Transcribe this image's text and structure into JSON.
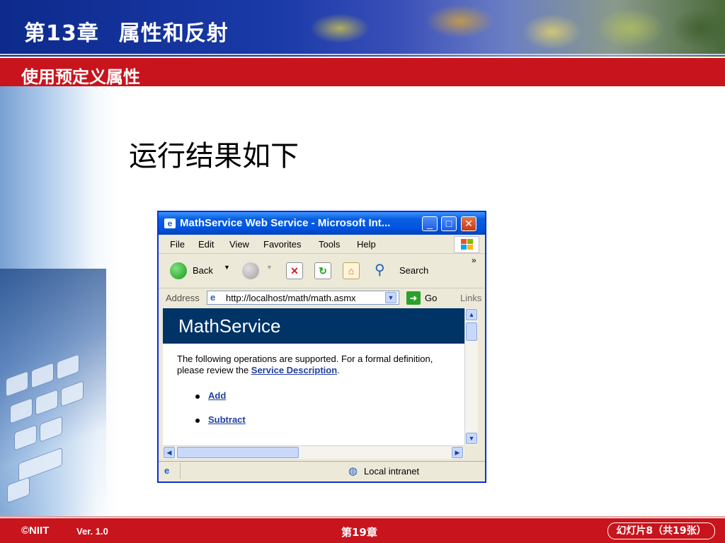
{
  "slide": {
    "title_part1": "第13章",
    "title_part2": "属性和反射",
    "subtitle": "使用预定义属性",
    "heading": "运行结果如下"
  },
  "browser": {
    "window_title": "MathService Web Service - Microsoft Int...",
    "menu": [
      "File",
      "Edit",
      "View",
      "Favorites",
      "Tools",
      "Help"
    ],
    "toolbar": {
      "back_label": "Back",
      "search_label": "Search",
      "more_label": "»"
    },
    "address": {
      "label": "Address",
      "url": "http://localhost/math/math.asmx",
      "go_label": "Go",
      "links_label": "Links"
    },
    "page": {
      "service_name": "MathService",
      "intro_text": "The following operations are supported. For a formal definition, please review the ",
      "service_description_link": "Service Description",
      "intro_end": ".",
      "operations": [
        "Add",
        "Subtract"
      ]
    },
    "status": {
      "zone_label": "Local intranet"
    }
  },
  "footer": {
    "logo": "©NIIT",
    "version": "Ver. 1.0",
    "chapter": "第19章",
    "slide_counter": "幻灯片8（共19张）"
  },
  "colors": {
    "header_blue": "#0d2a8c",
    "accent_red": "#c8141c",
    "banner_navy": "#003366",
    "xp_title_blue": "#0054e3"
  },
  "icons": [
    "ie-page-icon",
    "minimize-icon",
    "maximize-icon",
    "close-icon",
    "windows-logo-icon",
    "back-arrow-icon",
    "forward-arrow-icon",
    "stop-icon",
    "refresh-icon",
    "home-icon",
    "search-icon",
    "go-arrow-icon",
    "scroll-up-icon",
    "scroll-down-icon",
    "scroll-left-icon",
    "scroll-right-icon",
    "local-intranet-icon"
  ]
}
